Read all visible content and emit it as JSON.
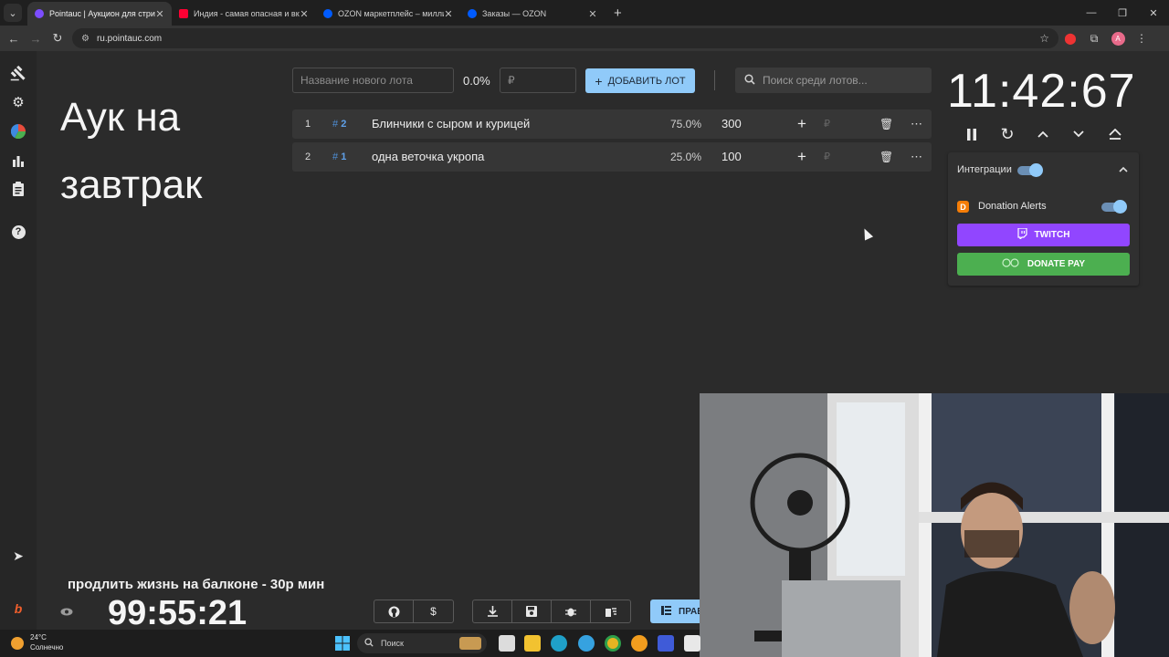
{
  "browser": {
    "tabs": [
      {
        "title": "Pointauc | Аукцион для стрим",
        "favicon_color": "#7c4dff",
        "active": true
      },
      {
        "title": "Индия - самая опасная и вкус",
        "favicon_color": "#ff0033",
        "active": false
      },
      {
        "title": "OZON маркетплейс – миллион",
        "favicon_color": "#005bff",
        "active": false
      },
      {
        "title": "Заказы — OZON",
        "favicon_color": "#005bff",
        "active": false
      }
    ],
    "url": "ru.pointauc.com",
    "profile_initial": "A"
  },
  "sidebar": {
    "icons": [
      "gavel-icon",
      "settings-icon",
      "pie-chart-icon",
      "bar-chart-icon",
      "clipboard-icon",
      "help-icon"
    ],
    "bottom_icons": [
      "telegram-icon",
      "boosty-icon"
    ]
  },
  "auction": {
    "title": "Аук на завтрак",
    "new_lot_placeholder": "Название нового лота",
    "new_lot_percent": "0.0%",
    "amount_placeholder": "₽",
    "add_lot_label": "ДОБАВИТЬ ЛОТ",
    "search_placeholder": "Поиск среди лотов...",
    "lots": [
      {
        "number": "1",
        "id": "2",
        "name": "Блинчики с сыром и курицей",
        "percent": "75.0%",
        "amount": "300"
      },
      {
        "number": "2",
        "id": "1",
        "name": "одна веточка укропа",
        "percent": "25.0%",
        "amount": "100"
      }
    ]
  },
  "timer": {
    "value": "11:42:67",
    "controls": [
      "pause-icon",
      "reset-icon",
      "increase-icon",
      "decrease-icon",
      "double-up-icon"
    ]
  },
  "integrations": {
    "title": "Интеграции",
    "enabled": true,
    "donation_alerts_label": "Donation Alerts",
    "donation_alerts_enabled": true,
    "twitch_label": "TWITCH",
    "twitch_color": "#9146ff",
    "donatepay_label": "DONATE PAY",
    "donatepay_color": "#4caf50"
  },
  "overlay": {
    "message": "продлить жизнь на балконе - 30р мин",
    "countdown": "99:55:21"
  },
  "bottom_toolbar": {
    "rules_label": "ПРАВ"
  },
  "taskbar": {
    "temperature": "24°C",
    "weather": "Солнечно",
    "search_label": "Поиск"
  },
  "colors": {
    "accent": "#90caf9",
    "background": "#2b2b2b",
    "row_background": "#363636"
  }
}
